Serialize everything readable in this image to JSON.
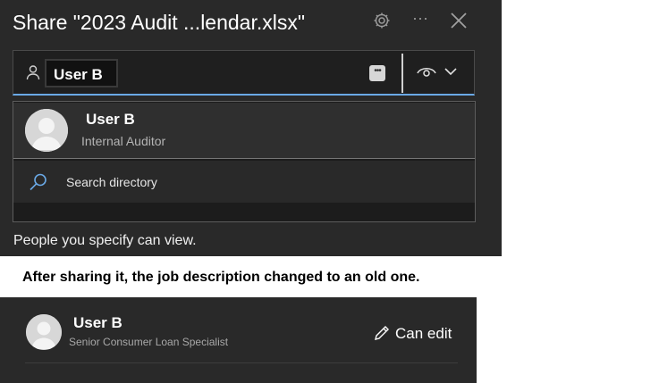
{
  "dialog": {
    "title": "Share \"2023 Audit ...lendar.xlsx\"",
    "header_icons": [
      "gear-icon",
      "more-icon",
      "close-icon"
    ],
    "more_glyph": "···"
  },
  "recipient_input": {
    "token": "User B",
    "icons": [
      "person-icon",
      "ellipsis-icon",
      "eye-icon",
      "chevron-down-icon"
    ],
    "ellipsis_glyph": "•••"
  },
  "suggestions": [
    {
      "name": "User B",
      "description": "Internal Auditor"
    }
  ],
  "search_directory": {
    "label": "Search directory",
    "icon": "search-icon"
  },
  "permission_note": "People you specify can view.",
  "annotation": "After sharing it, the job description changed to an old one.",
  "shared_with": [
    {
      "name": "User B",
      "description": "Senior Consumer Loan Specialist",
      "permission": "Can edit"
    }
  ],
  "colors": {
    "panel_bg": "#292929",
    "accent_underline": "#6aa9e6",
    "page_bg": "#ffffff"
  }
}
